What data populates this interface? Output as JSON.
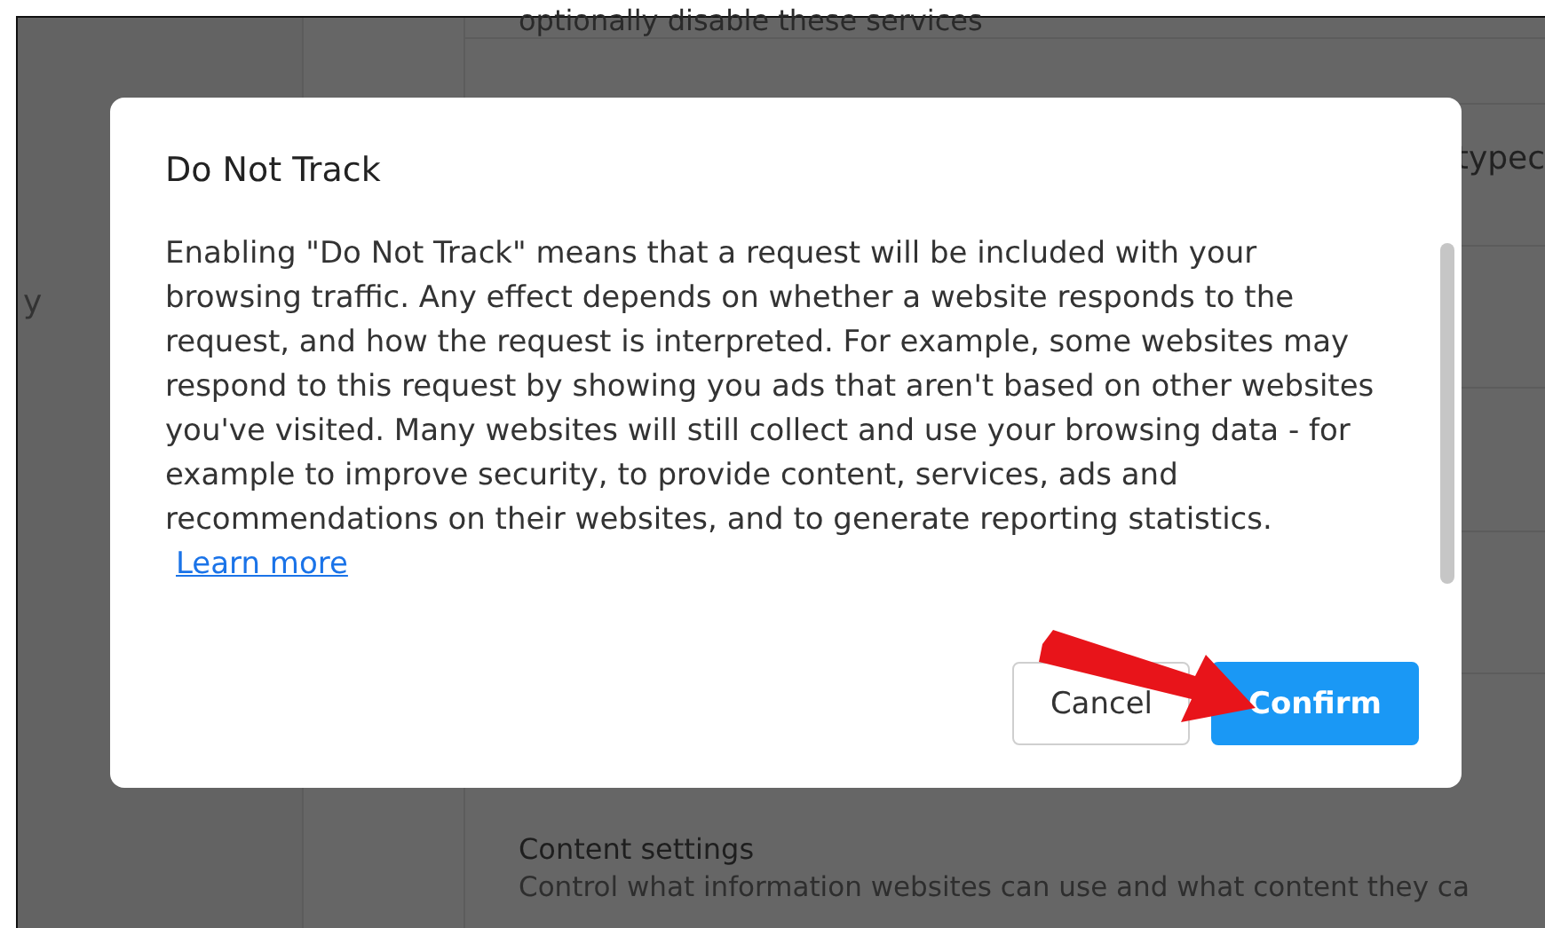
{
  "background": {
    "sidebar_text": "y",
    "section_text": "optionally disable these services",
    "row_text": "typec",
    "content_settings": {
      "title": "Content settings",
      "description": "Control what information websites can use and what content they ca"
    }
  },
  "dialog": {
    "title": "Do Not Track",
    "body": "Enabling \"Do Not Track\" means that a request will be included with your browsing traffic. Any effect depends on whether a website responds to the request, and how the request is interpreted. For example, some websites may respond to this request by showing you ads that aren't based on other websites you've visited. Many websites will still collect and use your browsing data - for example to improve security, to provide content, services, ads and recommendations on their websites, and to generate reporting statistics.",
    "link": "Learn more",
    "buttons": [
      {
        "label": "Cancel",
        "kind": "secondary"
      },
      {
        "label": "Confirm",
        "kind": "primary"
      }
    ]
  }
}
